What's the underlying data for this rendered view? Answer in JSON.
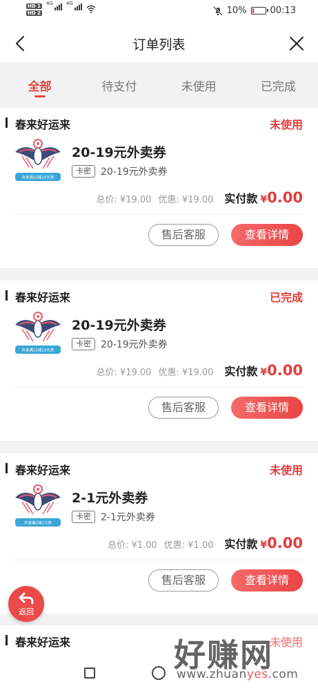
{
  "status_bar": {
    "hd1": "HD 1",
    "hd2": "HD 2",
    "net1": "4G",
    "net2": "4G",
    "battery": "10%",
    "battery_level": 0.1,
    "time": "00:13",
    "icons": [
      "signal-icon",
      "wifi-icon",
      "mute-icon",
      "battery-icon"
    ]
  },
  "header": {
    "title": "订单列表"
  },
  "tabs": [
    {
      "label": "全部",
      "active": true
    },
    {
      "label": "待支付",
      "active": false
    },
    {
      "label": "未使用",
      "active": false
    },
    {
      "label": "已完成",
      "active": false
    }
  ],
  "orders": [
    {
      "shop": "春来好运来",
      "status": "未使用",
      "thumb_text": "外卖满20减19元券",
      "title": "20-19元外卖券",
      "tag": "卡密",
      "subtitle": "20-19元外卖券",
      "total": "总价: ¥19.00",
      "discount": "优惠: ¥19.00",
      "paid_label": "实付款",
      "currency": "¥",
      "paid": "0.00",
      "btn_service": "售后客服",
      "btn_detail": "查看详情"
    },
    {
      "shop": "春来好运来",
      "status": "已完成",
      "thumb_text": "外卖满20减19元券",
      "title": "20-19元外卖券",
      "tag": "卡密",
      "subtitle": "20-19元外卖券",
      "total": "总价: ¥19.00",
      "discount": "优惠: ¥19.00",
      "paid_label": "实付款",
      "currency": "¥",
      "paid": "0.00",
      "btn_service": "售后客服",
      "btn_detail": "查看详情"
    },
    {
      "shop": "春来好运来",
      "status": "未使用",
      "thumb_text": "外卖满2减1元券",
      "title": "2-1元外卖券",
      "tag": "卡密",
      "subtitle": "2-1元外卖券",
      "total": "总价: ¥1.00",
      "discount": "优惠: ¥1.00",
      "paid_label": "实付款",
      "currency": "¥",
      "paid": "0.00",
      "btn_service": "售后客服",
      "btn_detail": "查看详情"
    },
    {
      "shop": "春来好运来",
      "status": "未使用"
    }
  ],
  "float_back": {
    "label": "返回"
  },
  "watermark": {
    "main": "好赚网",
    "url_prefix": "www.zhuan",
    "url_accent": "yes",
    "url_suffix": ".com"
  },
  "colors": {
    "accent": "#e84545",
    "status": "#e23d3d"
  }
}
